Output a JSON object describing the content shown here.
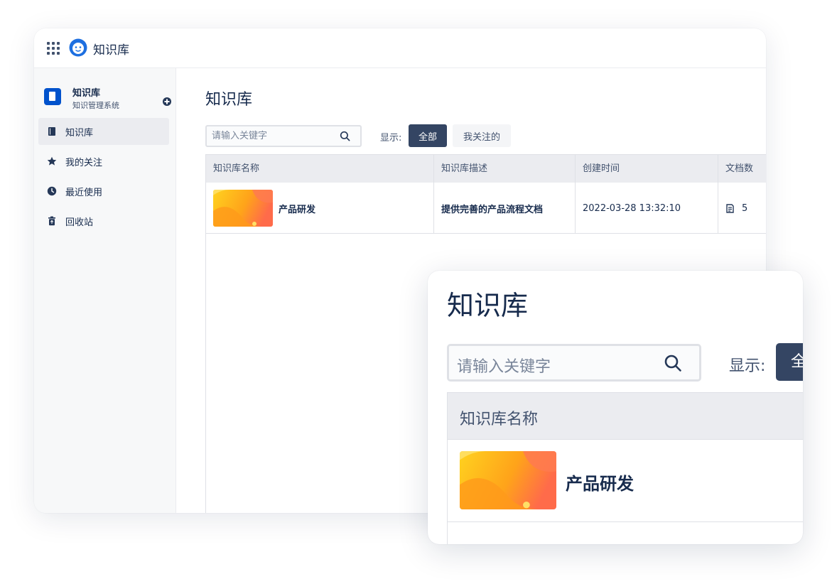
{
  "header": {
    "app_title": "知识库"
  },
  "sidebar": {
    "space_name": "知识库",
    "space_subtitle": "知识管理系统",
    "items": [
      {
        "label": "知识库",
        "icon": "book-icon",
        "active": true
      },
      {
        "label": "我的关注",
        "icon": "star-icon"
      },
      {
        "label": "最近使用",
        "icon": "clock-icon"
      },
      {
        "label": "回收站",
        "icon": "trash-icon"
      }
    ]
  },
  "main": {
    "title": "知识库",
    "search_placeholder": "请输入关键字",
    "filter_label": "显示:",
    "filter_all": "全部",
    "filter_followed": "我关注的",
    "table": {
      "headers": [
        "知识库名称",
        "知识库描述",
        "创建时间",
        "文档数"
      ],
      "rows": [
        {
          "name": "产品研发",
          "description": "提供完善的产品流程文档",
          "created": "2022-03-28 13:32:10",
          "docs": "5"
        }
      ]
    }
  },
  "zoom": {
    "title": "知识库",
    "search_placeholder": "请输入关键字",
    "filter_label": "显示:",
    "filter_all_partial": "全",
    "header": "知识库名称",
    "row_name": "产品研发"
  },
  "colors": {
    "primary_button": "#344563",
    "space_icon": "#0052cc",
    "thumb_gradient": [
      "#ffc21a",
      "#ff6b4a"
    ]
  }
}
